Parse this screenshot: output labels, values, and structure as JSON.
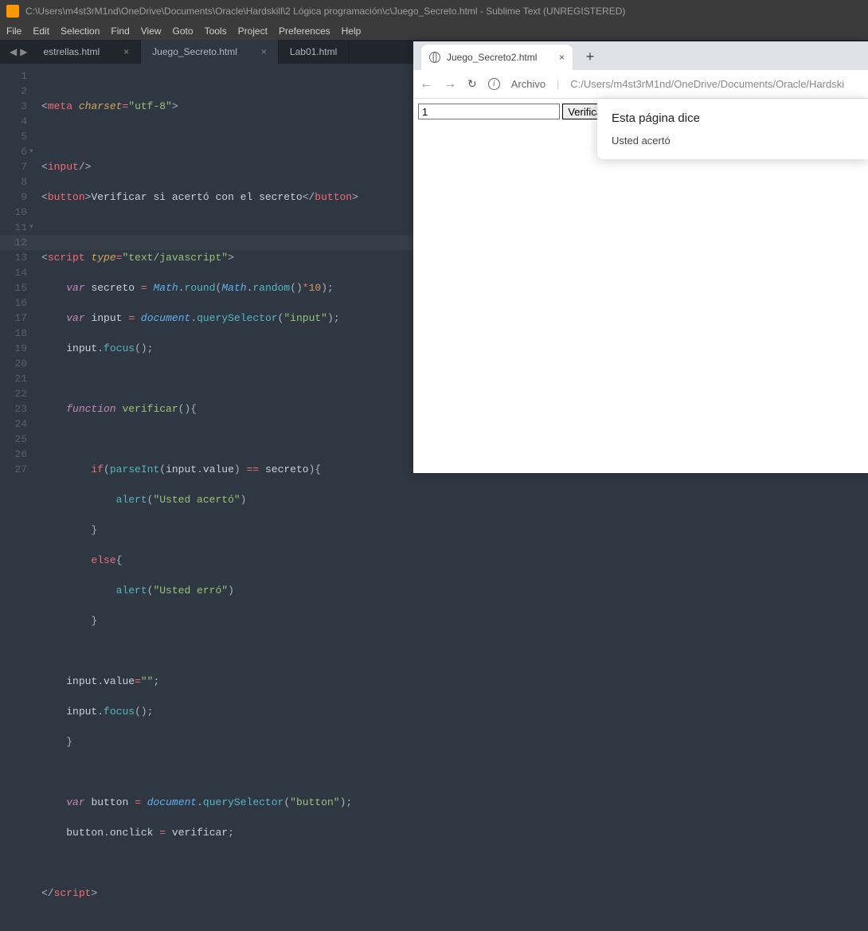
{
  "titlebar": {
    "path": "C:\\Users\\m4st3rM1nd\\OneDrive\\Documents\\Oracle\\Hardskill\\2 Lógica programación\\c\\Juego_Secreto.html - Sublime Text (UNREGISTERED)"
  },
  "menu": {
    "file": "File",
    "edit": "Edit",
    "selection": "Selection",
    "find": "Find",
    "view": "View",
    "goto": "Goto",
    "tools": "Tools",
    "project": "Project",
    "prefs": "Preferences",
    "help": "Help"
  },
  "tabs": {
    "t0": "estrellas.html",
    "t1": "Juego_Secreto.html",
    "t2": "Lab01.html",
    "close": "×"
  },
  "gutter": [
    "1",
    "2",
    "3",
    "4",
    "5",
    "6",
    "7",
    "8",
    "9",
    "10",
    "11",
    "12",
    "13",
    "14",
    "15",
    "16",
    "17",
    "18",
    "19",
    "20",
    "21",
    "22",
    "23",
    "24",
    "25",
    "26",
    "27"
  ],
  "code": {
    "l1a": "meta",
    "l1b": "charset",
    "l1c": "\"utf-8\"",
    "l3a": "input",
    "l4a": "button",
    "l4b": "Verificar si acertó con el secreto",
    "l4c": "button",
    "l6a": "script",
    "l6b": "type",
    "l6c": "\"text/javascript\"",
    "l7a": "var",
    "l7b": "secreto",
    "l7c": "Math",
    "l7d": "round",
    "l7e": "Math",
    "l7f": "random",
    "l7g": "10",
    "l8a": "var",
    "l8b": "input",
    "l8c": "document",
    "l8d": "querySelector",
    "l8e": "\"input\"",
    "l9a": "input",
    "l9b": "focus",
    "l11a": "function",
    "l11b": "verificar",
    "l13a": "if",
    "l13b": "parseInt",
    "l13c": "input",
    "l13d": "value",
    "l13e": "secreto",
    "l14a": "alert",
    "l14b": "\"Usted acertó\"",
    "l16a": "else",
    "l17a": "alert",
    "l17b": "\"Usted erró\"",
    "l20a": "input",
    "l20b": "value",
    "l20c": "\"\"",
    "l21a": "input",
    "l21b": "focus",
    "l24a": "var",
    "l24b": "button",
    "l24c": "document",
    "l24d": "querySelector",
    "l24e": "\"button\"",
    "l25a": "button",
    "l25b": "onclick",
    "l25c": "verificar",
    "l27a": "script"
  },
  "browser": {
    "tab_title": "Juego_Secreto2.html",
    "tab_close": "×",
    "newtab": "+",
    "back": "←",
    "fwd": "→",
    "reload": "↻",
    "url_label": "Archivo",
    "url_sep": "|",
    "url": "C:/Users/m4st3rM1nd/OneDrive/Documents/Oracle/Hardski",
    "input_value": "1",
    "button_label": "Verificar si acertó con el secreto",
    "alert_title": "Esta página dice",
    "alert_msg": "Usted acertó"
  }
}
